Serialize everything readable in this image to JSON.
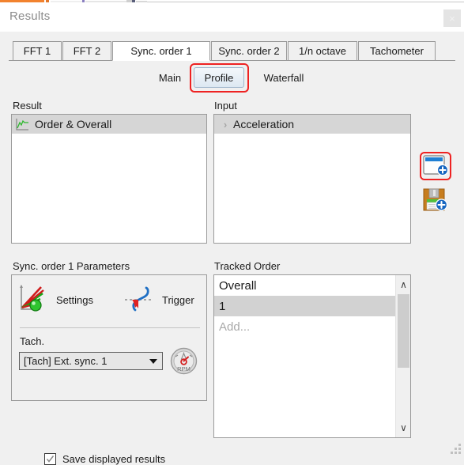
{
  "window": {
    "title": "Results",
    "close_label": "×"
  },
  "tabs": [
    {
      "label": "FFT 1",
      "selected": false
    },
    {
      "label": "FFT 2",
      "selected": false
    },
    {
      "label": "Sync. order 1",
      "selected": true
    },
    {
      "label": "Sync. order 2",
      "selected": false
    },
    {
      "label": "1/n octave",
      "selected": false
    },
    {
      "label": "Tachometer",
      "selected": false
    }
  ],
  "subtabs": [
    {
      "label": "Main",
      "selected": false
    },
    {
      "label": "Profile",
      "selected": true
    },
    {
      "label": "Waterfall",
      "selected": false
    }
  ],
  "result": {
    "label": "Result",
    "items": [
      {
        "label": "Order & Overall",
        "icon": "line-chart-icon",
        "selected": true
      }
    ]
  },
  "input": {
    "label": "Input",
    "items": [
      {
        "label": "Acceleration",
        "icon": "chevron-right-icon",
        "expander": "›",
        "selected": true
      }
    ]
  },
  "actions": {
    "new_window": {
      "icon": "new-window-add-icon",
      "highlighted": true
    },
    "save": {
      "icon": "save-disk-add-icon",
      "highlighted": false
    }
  },
  "parameters": {
    "label": "Sync. order 1  Parameters",
    "settings": {
      "label": "Settings",
      "icon": "order-settings-icon"
    },
    "trigger": {
      "label": "Trigger",
      "icon": "trigger-curve-icon"
    },
    "tach": {
      "label": "Tach.",
      "value": "[Tach] Ext. sync. 1",
      "options": [
        "[Tach] Ext. sync. 1"
      ],
      "gauge_icon": "rpm-gauge-icon",
      "gauge_text": "RPM"
    }
  },
  "tracked_order": {
    "label": "Tracked Order",
    "items": [
      {
        "label": "Overall",
        "selected": false,
        "placeholder": false
      },
      {
        "label": "1",
        "selected": true,
        "placeholder": false
      },
      {
        "label": "Add...",
        "selected": false,
        "placeholder": true
      }
    ],
    "scrollbar": {
      "up": "∧",
      "down": "∨"
    }
  },
  "footer": {
    "save_displayed_results": {
      "label": "Save displayed results",
      "checked": true
    }
  },
  "colors": {
    "window_background": "#f0f0f0",
    "titlebar_background": "#ffffff",
    "list_background": "#ffffff",
    "selection_gray": "#d6d6d6",
    "border_gray": "#9a9a9a",
    "annotation_red": "#ee2222",
    "accent_orange": "#f2822e",
    "tab_selected_white": "#ffffff",
    "subtab_selected_blue": "#dde8f2",
    "badge_blue": "#1565c0",
    "disk_orange": "#c77d1e",
    "green_marker": "#22bb22"
  }
}
